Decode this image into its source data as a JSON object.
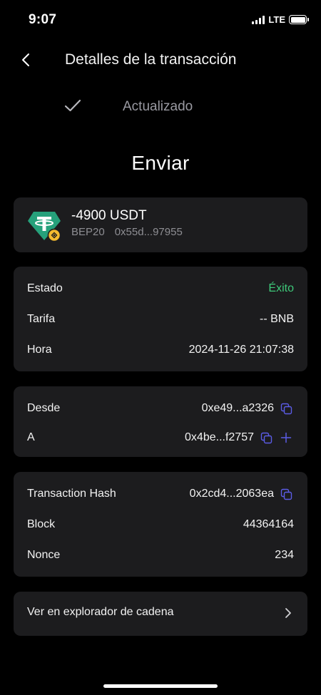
{
  "status_bar": {
    "time": "9:07",
    "network": "LTE"
  },
  "header": {
    "title": "Detalles de la transacción"
  },
  "updated": {
    "label": "Actualizado"
  },
  "main_title": "Enviar",
  "token": {
    "amount": "-4900 USDT",
    "network": "BEP20",
    "address": "0x55d...97955"
  },
  "details": {
    "status_label": "Estado",
    "status_value": "Éxito",
    "fee_label": "Tarifa",
    "fee_value": "-- BNB",
    "time_label": "Hora",
    "time_value": "2024-11-26 21:07:38"
  },
  "addresses": {
    "from_label": "Desde",
    "from_value": "0xe49...a2326",
    "to_label": "A",
    "to_value": "0x4be...f2757"
  },
  "hash": {
    "hash_label": "Transaction Hash",
    "hash_value": "0x2cd4...2063ea",
    "block_label": "Block",
    "block_value": "44364164",
    "nonce_label": "Nonce",
    "nonce_value": "234"
  },
  "explorer": {
    "label": "Ver en explorador de cadena"
  },
  "colors": {
    "success": "#3ec97a",
    "accent": "#5b5ce6",
    "card": "#1c1c1e",
    "tether": "#26a17b",
    "bnb": "#f3ba2f"
  },
  "icons": [
    "back-icon",
    "check-icon",
    "tether-icon",
    "bnb-badge-icon",
    "copy-icon",
    "add-icon",
    "chevron-right-icon"
  ]
}
